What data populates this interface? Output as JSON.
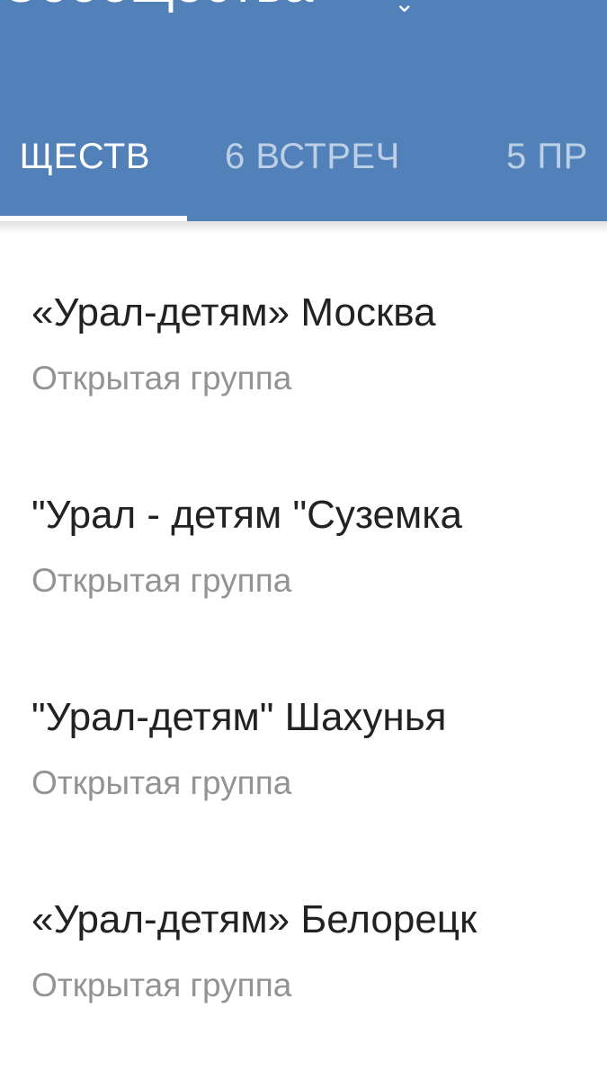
{
  "header": {
    "title": "Сообщества",
    "background_color": "#5181b8",
    "tabs": [
      {
        "label": "ЩЕСТВ",
        "active": true
      },
      {
        "label": "6 ВСТРЕЧ",
        "active": false
      },
      {
        "label": "5 ПР",
        "active": false
      }
    ]
  },
  "list": {
    "items": [
      {
        "title": "«Урал-детям» Москва",
        "subtitle": "Открытая группа"
      },
      {
        "title": "\"Урал - детям \"Суземка",
        "subtitle": "Открытая группа"
      },
      {
        "title": "\"Урал-детям\" Шахунья",
        "subtitle": "Открытая группа"
      },
      {
        "title": "«Урал-детям» Белорецк",
        "subtitle": "Открытая группа"
      }
    ]
  },
  "icons": {
    "title_dropdown": "chevron-down-icon"
  }
}
